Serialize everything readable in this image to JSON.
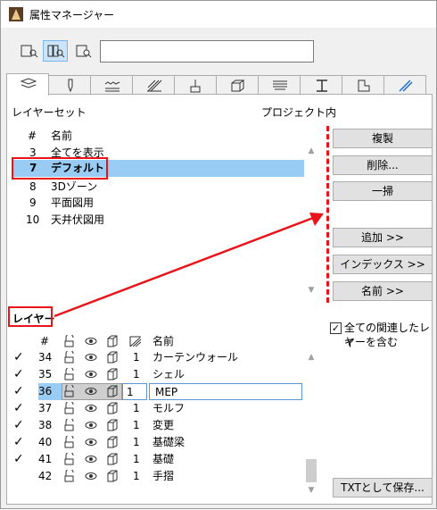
{
  "window": {
    "title": "属性マネージャー"
  },
  "search": {
    "value": ""
  },
  "layer_set_section": {
    "label": "レイヤーセット",
    "project_label": "プロジェクト内",
    "col_num": "#",
    "col_name": "名前",
    "rows": [
      {
        "num": "3",
        "name": "全てを表示"
      },
      {
        "num": "7",
        "name": "デフォルト"
      },
      {
        "num": "8",
        "name": "3Dゾーン"
      },
      {
        "num": "9",
        "name": "平面図用"
      },
      {
        "num": "10",
        "name": "天井伏図用"
      }
    ]
  },
  "buttons": {
    "duplicate": "複製",
    "delete": "削除...",
    "purge": "一掃",
    "add": "追加 >>",
    "index": "インデックス >>",
    "name": "名前 >>",
    "save_txt": "TXTとして保存..."
  },
  "layer_section": {
    "label": "レイヤー",
    "col_num": "#",
    "col_name": "名前",
    "include_related": "全ての関連したレイヤーを含む",
    "include_related_line1": "全ての関連したレイ",
    "include_related_line2": "ヤーを含む",
    "rows": [
      {
        "check": "✓",
        "num": "34",
        "pen": "1",
        "name": "カーテンウォール"
      },
      {
        "check": "✓",
        "num": "35",
        "pen": "1",
        "name": "シェル"
      },
      {
        "check": "✓",
        "num": "36",
        "pen": "1",
        "name": "MEP"
      },
      {
        "check": "✓",
        "num": "37",
        "pen": "1",
        "name": "モルフ"
      },
      {
        "check": "✓",
        "num": "38",
        "pen": "1",
        "name": "変更"
      },
      {
        "check": "✓",
        "num": "40",
        "pen": "1",
        "name": "基礎梁"
      },
      {
        "check": "✓",
        "num": "41",
        "pen": "1",
        "name": "基礎"
      },
      {
        "check": "",
        "num": "42",
        "pen": "1",
        "name": "手摺"
      }
    ]
  },
  "colors": {
    "highlight": "#e8141a",
    "selection": "#99ccf4"
  }
}
